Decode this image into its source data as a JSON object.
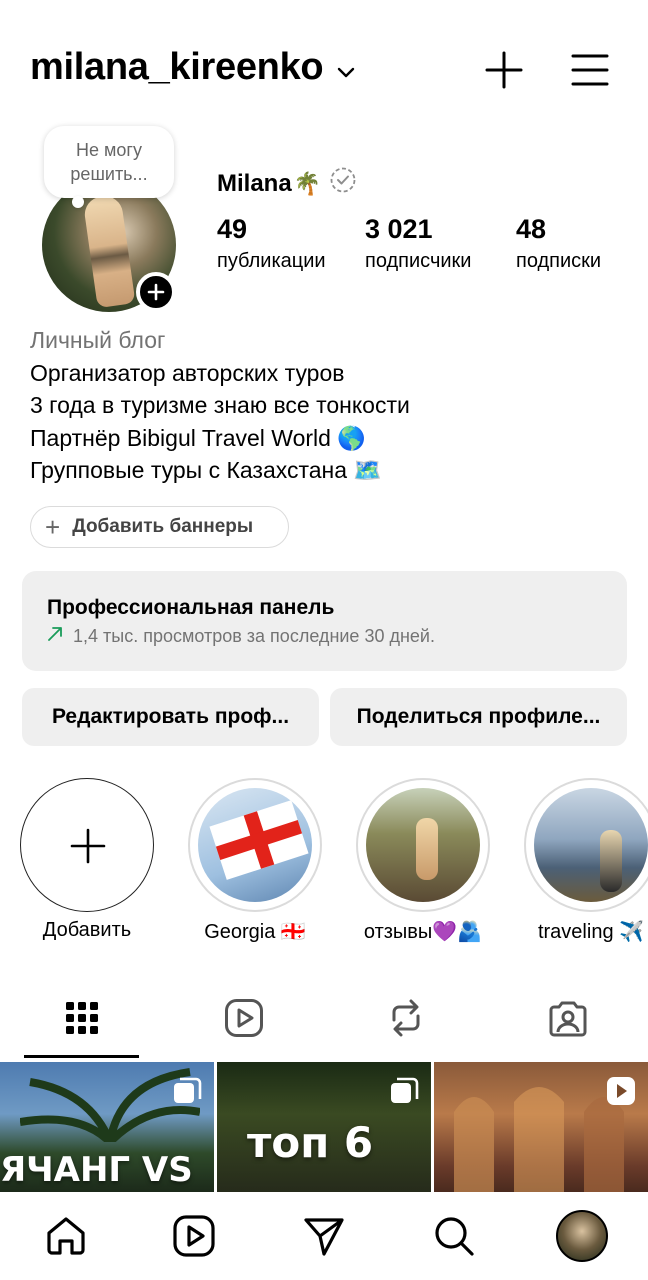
{
  "header": {
    "username": "milana_kireenko",
    "icons": [
      "chevron-down-icon",
      "plus-icon",
      "menu-icon"
    ]
  },
  "profile": {
    "note": "Не могу решить...",
    "full_name": "Milana",
    "name_emoji": "🌴",
    "stats": [
      {
        "value": "49",
        "label": "публикации"
      },
      {
        "value": "3 021",
        "label": "подписчики"
      },
      {
        "value": "48",
        "label": "подписки"
      }
    ]
  },
  "bio": {
    "category": "Личный блог",
    "lines": [
      "Организатор авторских туров",
      "3 года в туризме знаю все тонкости",
      "Партнёр Bibigul Travel World 🌎",
      "Групповые туры с Казахстана 🗺️"
    ]
  },
  "banners_chip": {
    "label": "Добавить баннеры"
  },
  "pro_panel": {
    "title": "Профессиональная панель",
    "subtitle": "1,4 тыс. просмотров за последние 30 дней."
  },
  "buttons": {
    "edit": "Редактировать проф...",
    "share": "Поделиться профиле..."
  },
  "highlights": [
    {
      "label": "Добавить"
    },
    {
      "label": "Georgia 🇬🇪"
    },
    {
      "label": "отзывы💜🫂"
    },
    {
      "label": "traveling ✈️"
    }
  ],
  "tabs": [
    "grid-icon",
    "reels-icon",
    "reposts-icon",
    "tagged-icon"
  ],
  "grid": [
    {
      "text": "ЯЧАНГ VS"
    },
    {
      "text": "топ 6"
    },
    {
      "text": ""
    }
  ],
  "bottom_nav": [
    "home-icon",
    "reels-icon",
    "direct-icon",
    "search-icon",
    "profile-avatar"
  ]
}
